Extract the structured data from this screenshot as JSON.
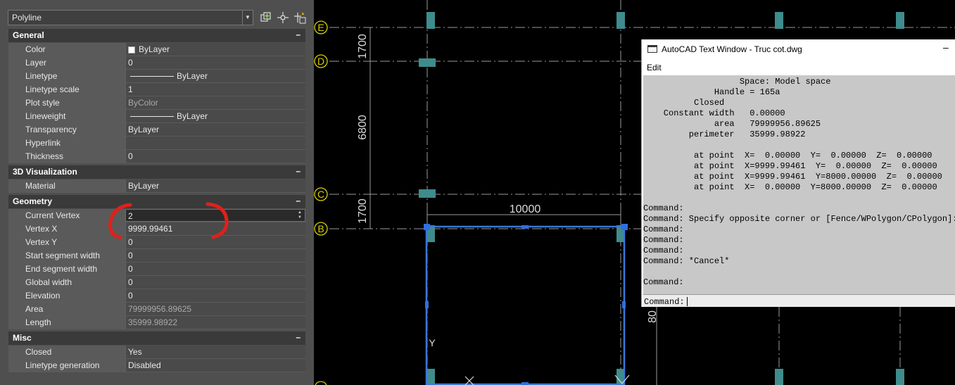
{
  "palette": {
    "selector_value": "Polyline",
    "sections": {
      "general": "General",
      "visualization": "3D Visualization",
      "geometry": "Geometry",
      "misc": "Misc"
    },
    "collapse_glyph": "–",
    "general": [
      {
        "label": "Color",
        "value": "ByLayer"
      },
      {
        "label": "Layer",
        "value": "0"
      },
      {
        "label": "Linetype",
        "value": "ByLayer"
      },
      {
        "label": "Linetype scale",
        "value": "1"
      },
      {
        "label": "Plot style",
        "value": "ByColor"
      },
      {
        "label": "Lineweight",
        "value": "ByLayer"
      },
      {
        "label": "Transparency",
        "value": "ByLayer"
      },
      {
        "label": "Hyperlink",
        "value": ""
      },
      {
        "label": "Thickness",
        "value": "0"
      }
    ],
    "visualization": [
      {
        "label": "Material",
        "value": "ByLayer"
      }
    ],
    "geometry": [
      {
        "label": "Current Vertex",
        "value": "2"
      },
      {
        "label": "Vertex X",
        "value": "9999.99461"
      },
      {
        "label": "Vertex Y",
        "value": "0"
      },
      {
        "label": "Start segment width",
        "value": "0"
      },
      {
        "label": "End segment width",
        "value": "0"
      },
      {
        "label": "Global width",
        "value": "0"
      },
      {
        "label": "Elevation",
        "value": "0"
      },
      {
        "label": "Area",
        "value": "79999956.89625"
      },
      {
        "label": "Length",
        "value": "35999.98922"
      }
    ],
    "misc": [
      {
        "label": "Closed",
        "value": "Yes"
      },
      {
        "label": "Linetype generation",
        "value": "Disabled"
      }
    ]
  },
  "drawing": {
    "bubbles": [
      "E",
      "D",
      "C",
      "B"
    ],
    "dimensions": {
      "d1": "1700",
      "d2": "6800",
      "d3": "1700",
      "top": "10000",
      "partial": "80"
    },
    "ucs": {
      "y": "Y"
    }
  },
  "text_window": {
    "title": "AutoCAD Text Window - Truc cot.dwg",
    "minimize": "–",
    "menu_edit": "Edit",
    "history": [
      "                   Space: Model space",
      "              Handle = 165a",
      "          Closed",
      "    Constant width   0.00000",
      "              area   79999956.89625",
      "         perimeter   35999.98922",
      "",
      "          at point  X=  0.00000  Y=  0.00000  Z=  0.00000",
      "          at point  X=9999.99461  Y=  0.00000  Z=  0.00000",
      "          at point  X=9999.99461  Y=8000.00000  Z=  0.00000",
      "          at point  X=  0.00000  Y=8000.00000  Z=  0.00000",
      "",
      "Command:",
      "Command: Specify opposite corner or [Fence/WPolygon/CPolygon]:",
      "Command:",
      "Command:",
      "Command:",
      "Command: *Cancel*",
      "",
      "Command:"
    ],
    "prompt": "Command:"
  },
  "colors": {
    "bubble": "#d6d000",
    "column": "#3f8c8c",
    "selection": "#3a78d8",
    "annotation_red": "#e0201a",
    "palette_bg": "#4f4f4f"
  }
}
